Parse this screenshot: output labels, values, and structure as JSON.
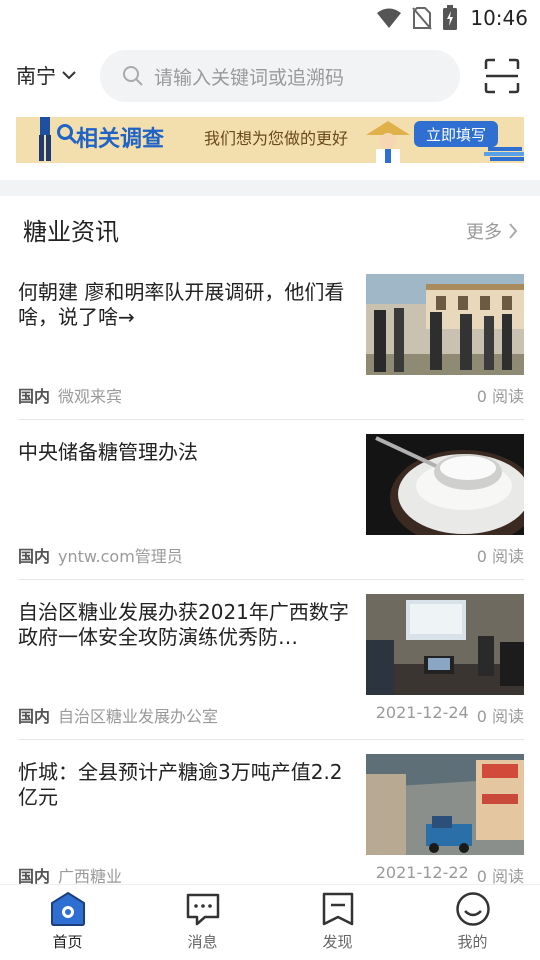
{
  "status_bar": {
    "time": "10:46"
  },
  "header": {
    "city": "南宁",
    "search_placeholder": "请输入关键词或追溯码"
  },
  "banner": {
    "title": "相关调查",
    "subtitle": "我们想为您做的更好",
    "button": "立即填写"
  },
  "section": {
    "title": "糖业资讯",
    "more": "更多"
  },
  "news": [
    {
      "title": "何朝建 廖和明率队开展调研，他们看啥，说了啥→",
      "tag": "国内",
      "source": "微观来宾",
      "date": "",
      "reads": "0 阅读"
    },
    {
      "title": "中央储备糖管理办法",
      "tag": "国内",
      "source": "yntw.com管理员",
      "date": "",
      "reads": "0 阅读"
    },
    {
      "title": "自治区糖业发展办获2021年广西数字政府一体安全攻防演练优秀防…",
      "tag": "国内",
      "source": "自治区糖业发展办公室",
      "date": "2021-12-24",
      "reads": "0 阅读"
    },
    {
      "title": "忻城：全县预计产糖逾3万吨产值2.2亿元",
      "tag": "国内",
      "source": "广西糖业",
      "date": "2021-12-22",
      "reads": "0 阅读"
    }
  ],
  "tabs": [
    {
      "label": "首页",
      "icon": "home-icon",
      "active": true
    },
    {
      "label": "消息",
      "icon": "message-icon",
      "active": false
    },
    {
      "label": "发现",
      "icon": "discover-icon",
      "active": false
    },
    {
      "label": "我的",
      "icon": "profile-icon",
      "active": false
    }
  ],
  "colors": {
    "accent": "#2f6fd2",
    "banner_bg": "#f3dfae",
    "muted": "#9a9a9a"
  }
}
